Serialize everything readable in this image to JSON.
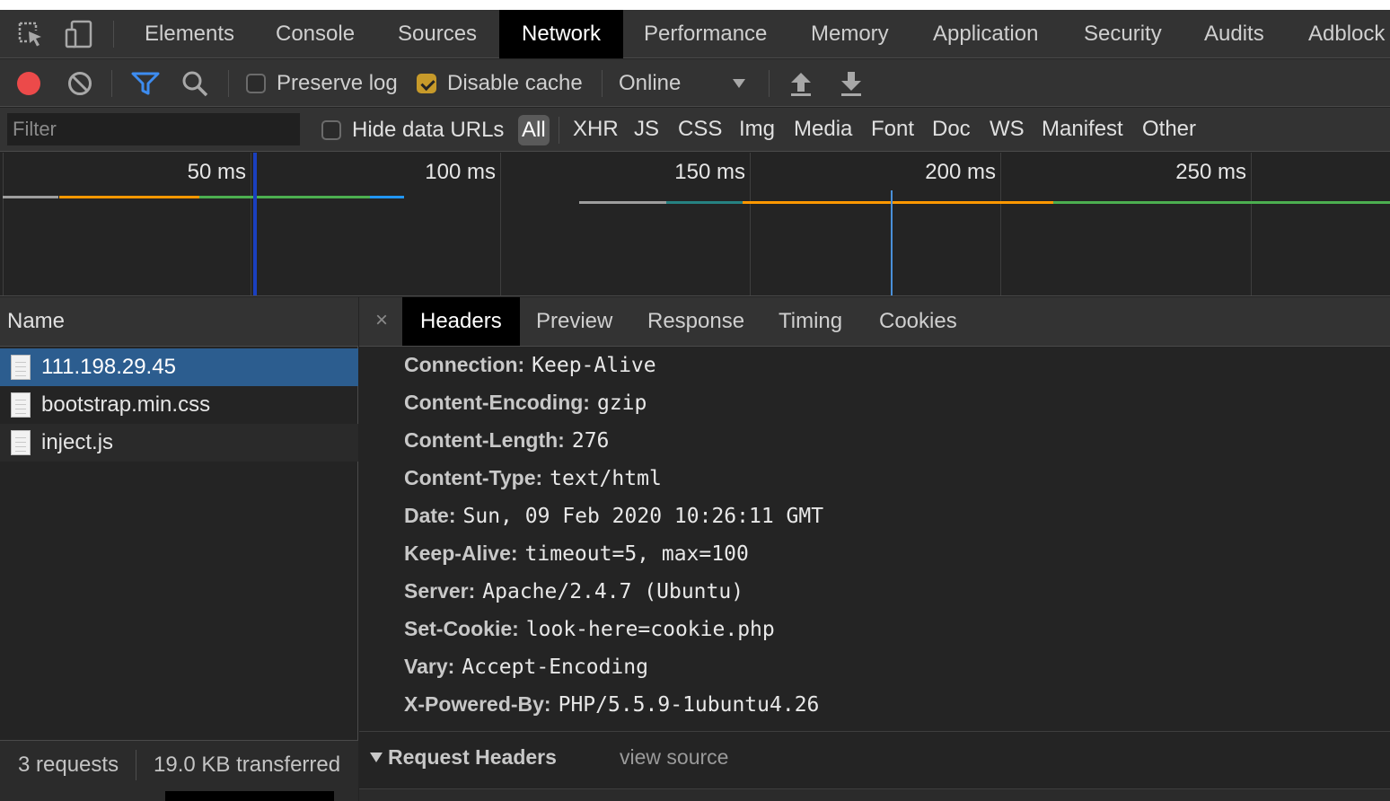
{
  "tabs": [
    "Elements",
    "Console",
    "Sources",
    "Network",
    "Performance",
    "Memory",
    "Application",
    "Security",
    "Audits",
    "Adblock"
  ],
  "active_tab": "Network",
  "toolbar": {
    "preserve_log_label": "Preserve log",
    "preserve_log_checked": false,
    "disable_cache_label": "Disable cache",
    "disable_cache_checked": true,
    "throttling_value": "Online"
  },
  "filter": {
    "placeholder": "Filter",
    "hide_data_urls_label": "Hide data URLs",
    "types": [
      "All",
      "XHR",
      "JS",
      "CSS",
      "Img",
      "Media",
      "Font",
      "Doc",
      "WS",
      "Manifest",
      "Other"
    ],
    "selected_type": "All"
  },
  "overview": {
    "time_labels": [
      "50 ms",
      "100 ms",
      "150 ms",
      "200 ms",
      "250 ms"
    ],
    "colors": {
      "queue": "#9e9e9e",
      "connect": "#ff9800",
      "wait": "#4caf50",
      "download": "#2196f3",
      "ssl": "#268282",
      "dom_content_loaded": "#1a3fbf",
      "load": "#4a90d9"
    }
  },
  "requests": {
    "header": "Name",
    "items": [
      {
        "name": "111.198.29.45",
        "selected": true
      },
      {
        "name": "bootstrap.min.css",
        "selected": false
      },
      {
        "name": "inject.js",
        "selected": false
      }
    ],
    "summary_requests": "3 requests",
    "summary_transferred": "19.0 KB transferred"
  },
  "details": {
    "close_label": "×",
    "tabs": [
      "Headers",
      "Preview",
      "Response",
      "Timing",
      "Cookies"
    ],
    "active_tab": "Headers",
    "response_headers": [
      {
        "key": "Connection:",
        "value": "Keep-Alive"
      },
      {
        "key": "Content-Encoding:",
        "value": "gzip"
      },
      {
        "key": "Content-Length:",
        "value": "276"
      },
      {
        "key": "Content-Type:",
        "value": "text/html"
      },
      {
        "key": "Date:",
        "value": "Sun, 09 Feb 2020 10:26:11 GMT"
      },
      {
        "key": "Keep-Alive:",
        "value": "timeout=5, max=100"
      },
      {
        "key": "Server:",
        "value": "Apache/2.4.7 (Ubuntu)"
      },
      {
        "key": "Set-Cookie:",
        "value": "look-here=cookie.php"
      },
      {
        "key": "Vary:",
        "value": "Accept-Encoding"
      },
      {
        "key": "X-Powered-By:",
        "value": "PHP/5.5.9-1ubuntu4.26"
      }
    ],
    "request_headers_title": "Request Headers",
    "view_source_label": "view source"
  }
}
